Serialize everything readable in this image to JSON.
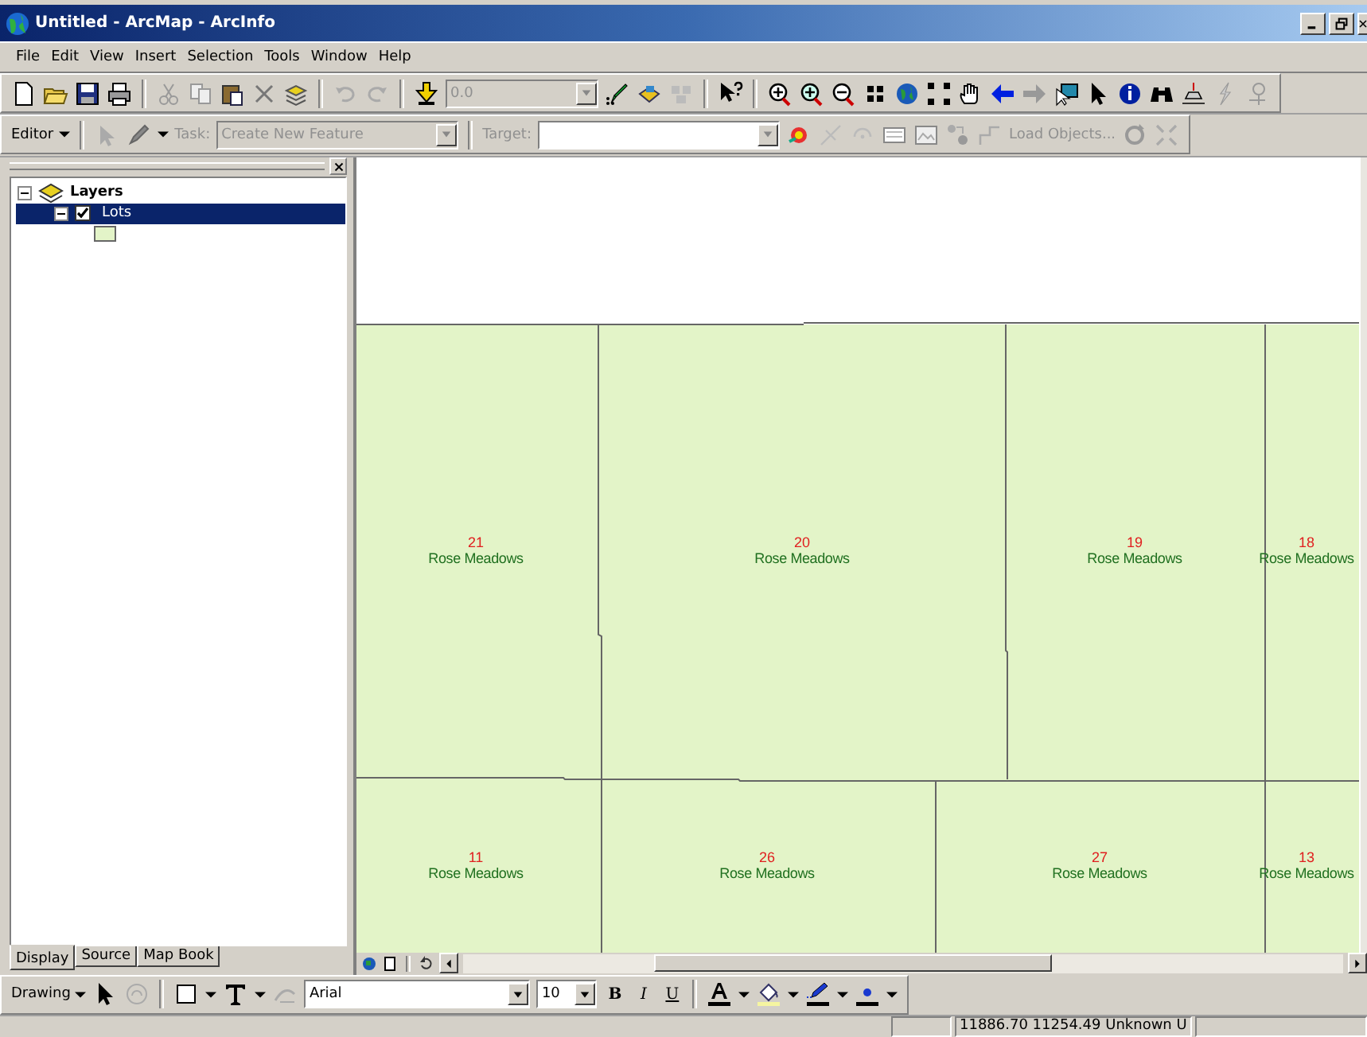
{
  "window": {
    "title": "Untitled - ArcMap - ArcInfo"
  },
  "menu": [
    "File",
    "Edit",
    "View",
    "Insert",
    "Selection",
    "Tools",
    "Window",
    "Help"
  ],
  "standard_toolbar": {
    "scale": "0.0"
  },
  "editor_toolbar": {
    "editor": "Editor",
    "task_label": "Task:",
    "task": "Create New Feature",
    "target_label": "Target:",
    "load_objects": "Load Objects..."
  },
  "toc": {
    "root": {
      "label": "Layers",
      "expanded": true,
      "children": [
        {
          "label": "Lots",
          "checked": true,
          "expanded": true,
          "selected": true
        }
      ]
    },
    "tabs": [
      {
        "label": "Display",
        "selected": true
      },
      {
        "label": "Source",
        "selected": false
      },
      {
        "label": "Map Book",
        "selected": false
      }
    ]
  },
  "map": {
    "parcels": [
      {
        "number": "21",
        "name": "Rose Meadows"
      },
      {
        "number": "20",
        "name": "Rose Meadows"
      },
      {
        "number": "19",
        "name": "Rose Meadows"
      },
      {
        "number": "18",
        "name": "Rose Meadows"
      },
      {
        "number": "11",
        "name": "Rose Meadows"
      },
      {
        "number": "26",
        "name": "Rose Meadows"
      },
      {
        "number": "27",
        "name": "Rose Meadows"
      },
      {
        "number": "13",
        "name": "Rose Meadows"
      }
    ]
  },
  "drawing_toolbar": {
    "drawing": "Drawing",
    "font": "Arial",
    "size": "10",
    "bold": "B",
    "italic": "I",
    "underline": "U"
  },
  "status_bar": {
    "coordinates": "11886.70  11254.49 Unknown U"
  }
}
